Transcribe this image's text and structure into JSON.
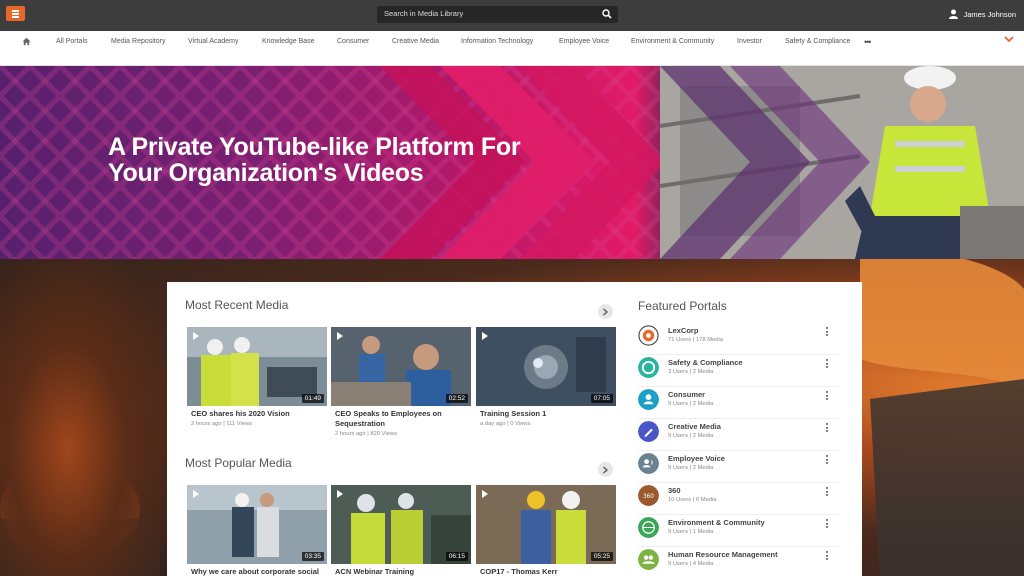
{
  "header": {
    "search_placeholder": "Search in Media Library",
    "user_name": "James Johnson"
  },
  "nav": {
    "items": [
      "All Portals",
      "Media Repository",
      "Virtual Academy",
      "Knowledge Base",
      "Consumer",
      "Creative Media",
      "Information Technology",
      "Employee Voice",
      "Environment & Community",
      "Investor",
      "Safety & Compliance"
    ],
    "more": "•••"
  },
  "hero": {
    "title_line1": "A Private YouTube-like Platform For",
    "title_line2": "Your Organization's Videos"
  },
  "most_recent": {
    "title": "Most Recent Media",
    "items": [
      {
        "title": "CEO shares his 2020 Vision",
        "meta": "2 hours ago | 111 Views",
        "duration": "01:49"
      },
      {
        "title": "CEO Speaks to Employees on Sequestration",
        "meta": "2 hours ago | 820 Views",
        "duration": "02:52"
      },
      {
        "title": "Training Session 1",
        "meta": "a day ago | 0 Views",
        "duration": "07:05"
      }
    ]
  },
  "most_popular": {
    "title": "Most Popular Media",
    "items": [
      {
        "title": "Why we care about corporate social",
        "duration": "03:35"
      },
      {
        "title": "ACN Webinar Training",
        "duration": "06:15"
      },
      {
        "title": "COP17 - Thomas Kerr",
        "duration": "05:25"
      }
    ]
  },
  "featured_portals": {
    "title": "Featured Portals",
    "items": [
      {
        "name": "LexCorp",
        "meta": "71 Users | 178 Media",
        "color": "#ffffff"
      },
      {
        "name": "Safety & Compliance",
        "meta": "3 Users | 2 Media",
        "color": "#2ab3a0"
      },
      {
        "name": "Consumer",
        "meta": "9 Users | 2 Media",
        "color": "#1da0c8"
      },
      {
        "name": "Creative Media",
        "meta": "9 Users | 2 Media",
        "color": "#4a56c8"
      },
      {
        "name": "Employee Voice",
        "meta": "9 Users | 2 Media",
        "color": "#6b8291"
      },
      {
        "name": "360",
        "meta": "10 Users | 0 Media",
        "color": "#9a5a2e"
      },
      {
        "name": "Environment & Community",
        "meta": "9 Users | 1 Media",
        "color": "#3aa657"
      },
      {
        "name": "Human Resource Management",
        "meta": "9 Users | 4 Media",
        "color": "#7cb342"
      }
    ]
  },
  "colors": {
    "accent": "#e8672b",
    "topbar": "#3d3d3d"
  }
}
